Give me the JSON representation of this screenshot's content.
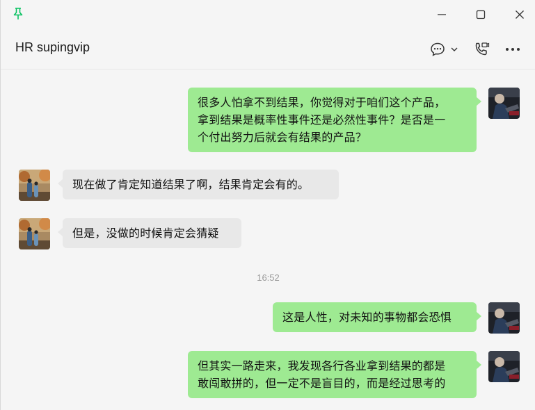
{
  "header": {
    "title": "HR supingvip",
    "icons": [
      "chat-bubble-icon",
      "chevron-down-icon",
      "voice-call-icon",
      "more-icon"
    ]
  },
  "titlebar": {
    "icons": [
      "pin-icon",
      "minimize-icon",
      "maximize-icon",
      "close-icon"
    ]
  },
  "messages": [
    {
      "side": "me",
      "lines": [
        "很多人怕拿不到结果，你觉得对于咱们这个产品，",
        "拿到结果是概率性事件还是必然性事件？是否是一",
        "个付出努力后就会有结果的产品？"
      ]
    },
    {
      "side": "other",
      "lines": [
        "现在做了肯定知道结果了啊，结果肯定会有的。"
      ]
    },
    {
      "side": "other",
      "lines": [
        "但是，没做的时候肯定会猜疑"
      ]
    },
    {
      "side": "me",
      "lines": [
        "这是人性，对未知的事物都会恐惧"
      ]
    },
    {
      "side": "me",
      "lines": [
        "但其实一路走来，我发现各行各业拿到结果的都是",
        "敢闯敢拼的，但一定不是盲目的，而是经过思考的"
      ]
    }
  ],
  "timestamp": "16:52",
  "colors": {
    "my_bubble": "#9eea92",
    "other_bubble": "#e8e8e8",
    "accent": "#07c160"
  }
}
